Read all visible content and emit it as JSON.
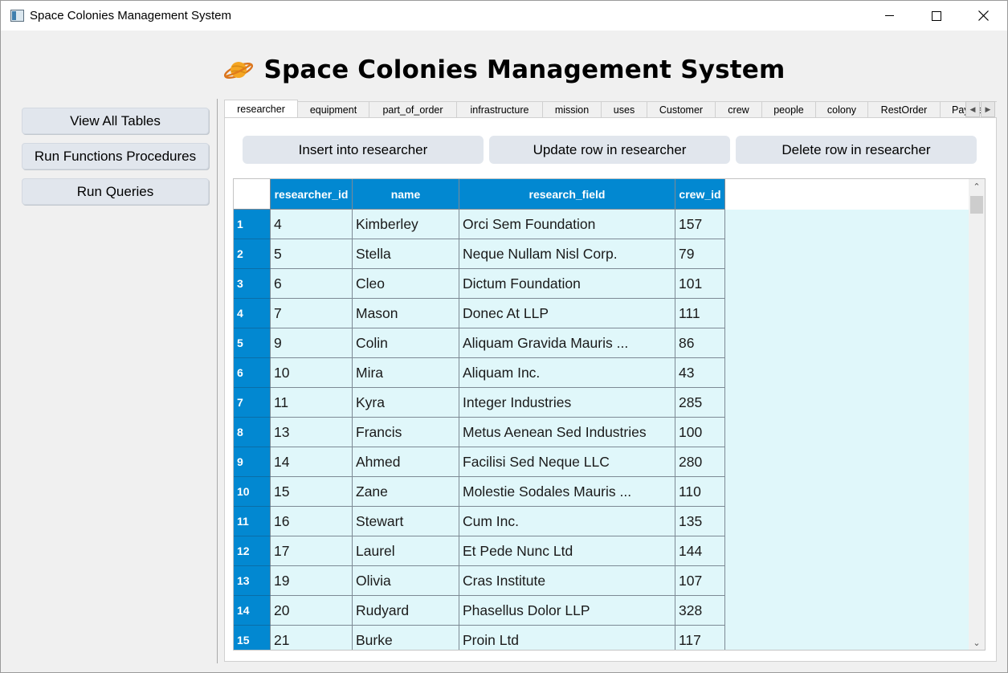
{
  "window": {
    "title": "Space Colonies Management System"
  },
  "header": {
    "title": "Space Colonies Management System",
    "icon": "ringed-planet-icon"
  },
  "sidebar": {
    "buttons": [
      "View All Tables",
      "Run Functions  Procedures",
      "Run Queries"
    ]
  },
  "tabs": [
    "researcher",
    "equipment",
    "part_of_order",
    "infrastructure",
    "mission",
    "uses",
    "Customer",
    "crew",
    "people",
    "colony",
    "RestOrder",
    "Payment"
  ],
  "active_tab": "researcher",
  "actions": {
    "insert_label": "Insert into researcher",
    "update_label": "Update row in researcher",
    "delete_label": "Delete row in researcher"
  },
  "table": {
    "columns": [
      "researcher_id",
      "name",
      "research_field",
      "crew_id"
    ],
    "rows": [
      {
        "num": "1",
        "cells": [
          "4",
          "Kimberley",
          "Orci Sem Foundation",
          "157"
        ]
      },
      {
        "num": "2",
        "cells": [
          "5",
          "Stella",
          "Neque Nullam Nisl Corp.",
          "79"
        ]
      },
      {
        "num": "3",
        "cells": [
          "6",
          "Cleo",
          "Dictum Foundation",
          "101"
        ]
      },
      {
        "num": "4",
        "cells": [
          "7",
          "Mason",
          "Donec At LLP",
          "111"
        ]
      },
      {
        "num": "5",
        "cells": [
          "9",
          "Colin",
          "Aliquam Gravida Mauris ...",
          "86"
        ]
      },
      {
        "num": "6",
        "cells": [
          "10",
          "Mira",
          "Aliquam Inc.",
          "43"
        ]
      },
      {
        "num": "7",
        "cells": [
          "11",
          "Kyra",
          "Integer Industries",
          "285"
        ]
      },
      {
        "num": "8",
        "cells": [
          "13",
          "Francis",
          "Metus Aenean Sed Industries",
          "100"
        ]
      },
      {
        "num": "9",
        "cells": [
          "14",
          "Ahmed",
          "Facilisi Sed Neque LLC",
          "280"
        ]
      },
      {
        "num": "10",
        "cells": [
          "15",
          "Zane",
          "Molestie Sodales Mauris ...",
          "110"
        ]
      },
      {
        "num": "11",
        "cells": [
          "16",
          "Stewart",
          "Cum Inc.",
          "135"
        ]
      },
      {
        "num": "12",
        "cells": [
          "17",
          "Laurel",
          "Et Pede Nunc Ltd",
          "144"
        ]
      },
      {
        "num": "13",
        "cells": [
          "19",
          "Olivia",
          "Cras Institute",
          "107"
        ]
      },
      {
        "num": "14",
        "cells": [
          "20",
          "Rudyard",
          "Phasellus Dolor LLP",
          "328"
        ]
      },
      {
        "num": "15",
        "cells": [
          "21",
          "Burke",
          "Proin Ltd",
          "117"
        ]
      }
    ]
  },
  "colors": {
    "header_blue": "#0288d1",
    "cell_bg": "#e0f7fa",
    "button_bg": "#e1e6ed",
    "planet_orange": "#f5a623"
  }
}
